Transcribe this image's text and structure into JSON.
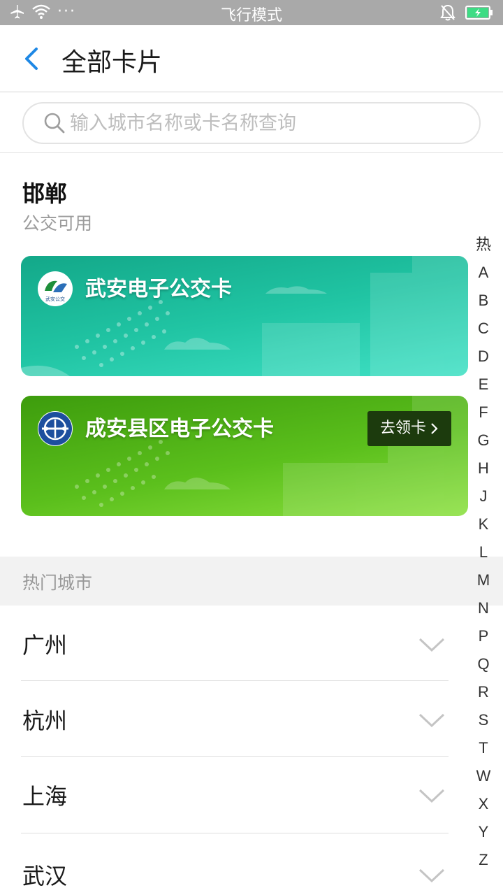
{
  "status_bar": {
    "center_text": "飞行模式",
    "more_dots": "···"
  },
  "header": {
    "title": "全部卡片"
  },
  "search": {
    "placeholder": "输入城市名称或卡名称查询"
  },
  "city": {
    "name": "邯郸",
    "subtitle": "公交可用"
  },
  "cards": [
    {
      "name": "武安电子公交卡",
      "logo_text": "武安公交",
      "colors": [
        "#13a889",
        "#3fe0c4"
      ]
    },
    {
      "name": "成安县区电子公交卡",
      "button_label": "去领卡",
      "colors": [
        "#3d9c0d",
        "#8be03f"
      ]
    }
  ],
  "hot": {
    "label": "热门城市",
    "cities": [
      "广州",
      "杭州",
      "上海",
      "武汉"
    ]
  },
  "index": [
    "热",
    "A",
    "B",
    "C",
    "D",
    "E",
    "F",
    "G",
    "H",
    "J",
    "K",
    "L",
    "M",
    "N",
    "P",
    "Q",
    "R",
    "S",
    "T",
    "W",
    "X",
    "Y",
    "Z"
  ],
  "icons": {
    "airplane": "airplane-icon",
    "wifi": "wifi-icon",
    "bell_off": "bell-off-icon",
    "battery": "battery-charging-icon",
    "back": "back-arrow-icon",
    "search": "search-icon",
    "chevron": "chevron-down-icon"
  },
  "accent_color": "#1e88e5"
}
